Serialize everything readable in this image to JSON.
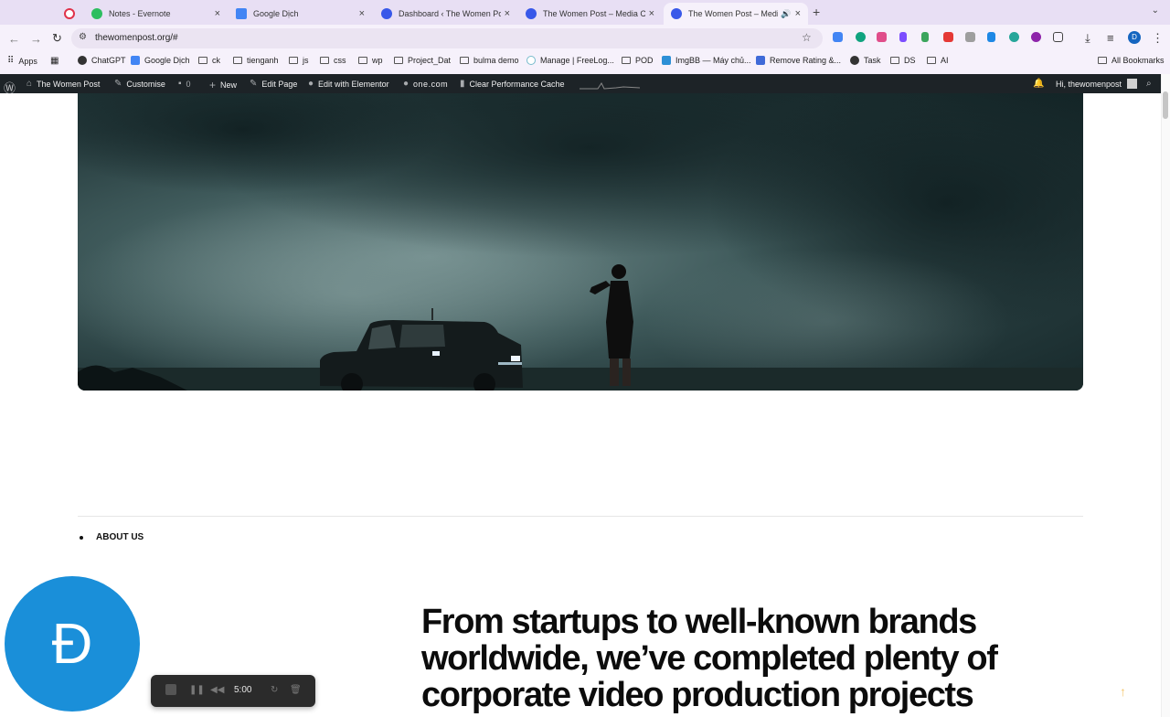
{
  "browser": {
    "tabs": [
      {
        "label": "",
        "color": "#e0334a"
      },
      {
        "label": "Notes - Evernote",
        "color": "#2dbe60"
      },
      {
        "label": "Google Dịch",
        "color": "#4285f4"
      },
      {
        "label": "Dashboard ‹ The Women Pos",
        "color": "#3858e9"
      },
      {
        "label": "The Women Post – Media Co",
        "color": "#3858e9"
      },
      {
        "label": "The Women Post – Media",
        "color": "#3858e9",
        "active": true
      }
    ],
    "url": "thewomenpost.org/#",
    "profile_initial": "D"
  },
  "bookmarks": {
    "items": [
      "Apps",
      "ChatGPT",
      "Google Dịch",
      "ck",
      "tienganh",
      "js",
      "css",
      "wp",
      "Project_Dat",
      "bulma demo",
      "Manage | FreeLog...",
      "POD",
      "ImgBB — Máy chủ...",
      "Remove Rating &...",
      "Task",
      "DS",
      "AI"
    ],
    "all_bookmarks": "All Bookmarks"
  },
  "adminbar": {
    "site": "The Women Post",
    "customise": "Customise",
    "comments": "0",
    "new": "New",
    "edit_page": "Edit Page",
    "edit_elementor": "Edit with Elementor",
    "onecom": "one.com",
    "clear_cache": "Clear Performance Cache",
    "greeting": "Hi, thewomenpost"
  },
  "page": {
    "about_label": "ABOUT US",
    "headline": "From startups to well-known brands worldwide, we’ve completed plenty of corporate video production projects"
  },
  "widgets": {
    "avatar_letter": "Đ",
    "record_time": "5:00"
  }
}
